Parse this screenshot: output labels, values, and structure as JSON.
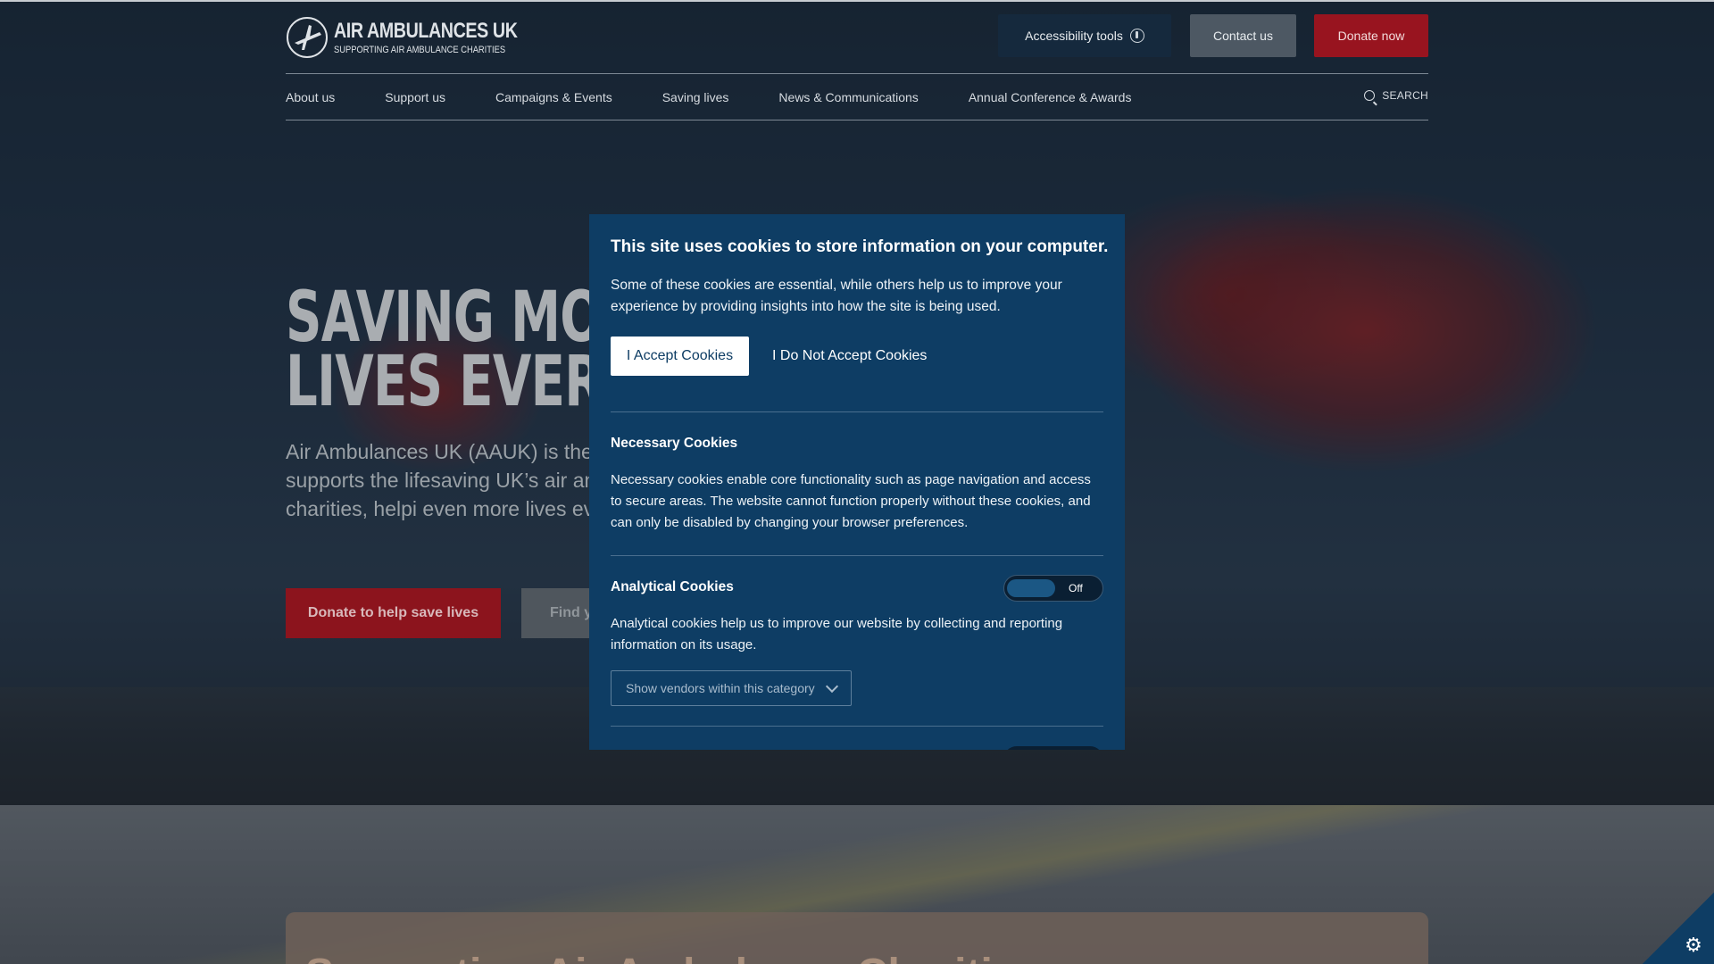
{
  "header": {
    "logo_title": "AIR AMBULANCES UK",
    "logo_subtitle": "SUPPORTING AIR AMBULANCE CHARITIES",
    "accessibility_label": "Accessibility tools",
    "contact_label": "Contact us",
    "donate_label": "Donate now"
  },
  "nav": {
    "items": [
      {
        "label": "About us"
      },
      {
        "label": "Support us"
      },
      {
        "label": "Campaigns & Events"
      },
      {
        "label": "Saving lives"
      },
      {
        "label": "News & Communications"
      },
      {
        "label": "Annual Conference & Awards"
      }
    ],
    "search_label": "SEARCH"
  },
  "hero": {
    "title": "SAVING MORE\nLIVES EVERY D",
    "description": "Air Ambulances UK (AAUK) is the charity that supports the lifesaving UK’s air ambulance charities, helpi even more lives every day.",
    "donate_button": "Donate to help save lives",
    "find_button": "Find y"
  },
  "bottom_card": {
    "title": "Supporting Air Ambulance Charities"
  },
  "cookie": {
    "title": "This site uses cookies to store information on your computer.",
    "intro": "Some of these cookies are essential, while others help us to improve your experience by providing insights into how the site is being used.",
    "accept_label": "I Accept Cookies",
    "reject_label": "I Do Not Accept Cookies",
    "necessary_heading": "Necessary Cookies",
    "necessary_text": "Necessary cookies enable core functionality such as page navigation and access to secure areas. The website cannot function properly without these cookies, and can only be disabled by changing your browser preferences.",
    "analytical_heading": "Analytical Cookies",
    "analytical_toggle": "Off",
    "analytical_text": "Analytical cookies help us to improve our website by collecting and reporting information on its usage.",
    "vendors_label": "Show vendors within this category"
  },
  "colors": {
    "cookie_panel": "#0e3d64",
    "donate_red": "#98141f",
    "accessibility_bg": "#15293d",
    "contact_bg": "#4d5863"
  }
}
